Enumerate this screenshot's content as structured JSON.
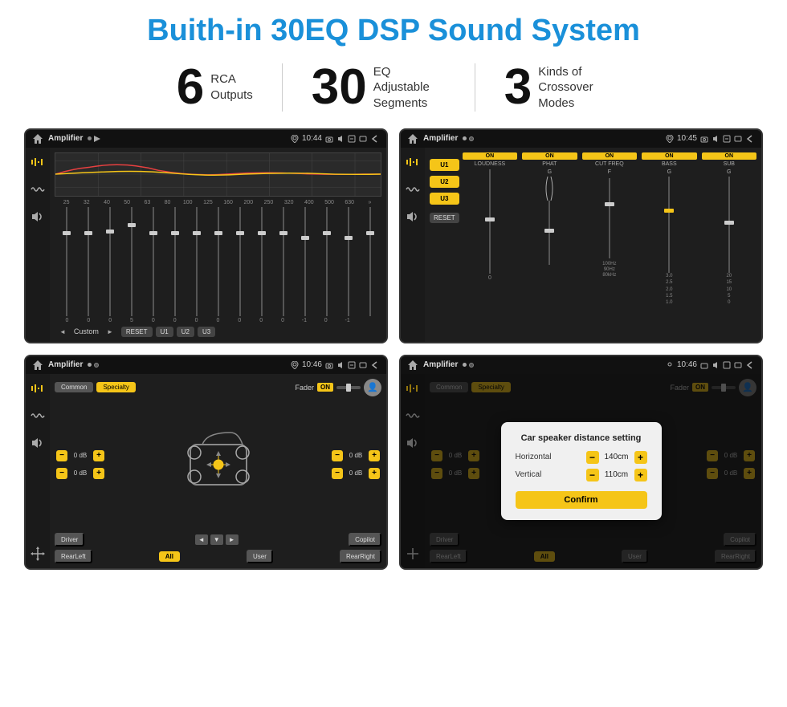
{
  "page": {
    "title": "Buith-in 30EQ DSP Sound System",
    "stats": [
      {
        "number": "6",
        "label": "RCA\nOutputs"
      },
      {
        "number": "30",
        "label": "EQ Adjustable\nSegments"
      },
      {
        "number": "3",
        "label": "Kinds of\nCrossover Modes"
      }
    ],
    "screens": [
      {
        "id": "eq-screen",
        "status_title": "Amplifier",
        "status_time": "10:44",
        "eq_freqs": [
          "25",
          "32",
          "40",
          "50",
          "63",
          "80",
          "100",
          "125",
          "160",
          "200",
          "250",
          "320",
          "400",
          "500",
          "630"
        ],
        "eq_values": [
          "0",
          "0",
          "0",
          "5",
          "0",
          "0",
          "0",
          "0",
          "0",
          "0",
          "0",
          "-1",
          "0",
          "-1"
        ],
        "eq_preset": "Custom",
        "eq_buttons": [
          "RESET",
          "U1",
          "U2",
          "U3"
        ]
      },
      {
        "id": "mixer-screen",
        "status_title": "Amplifier",
        "status_time": "10:45",
        "presets": [
          "U1",
          "U2",
          "U3"
        ],
        "channels": [
          {
            "on_label": "ON",
            "name": "LOUDNESS"
          },
          {
            "on_label": "ON",
            "name": "PHAT"
          },
          {
            "on_label": "ON",
            "name": "CUT FREQ"
          },
          {
            "on_label": "ON",
            "name": "BASS"
          },
          {
            "on_label": "ON",
            "name": "SUB"
          }
        ],
        "reset_label": "RESET"
      },
      {
        "id": "fader-screen",
        "status_title": "Amplifier",
        "status_time": "10:46",
        "tab_common": "Common",
        "tab_specialty": "Specialty",
        "fader_label": "Fader",
        "fader_on": "ON",
        "db_values": [
          "0 dB",
          "0 dB",
          "0 dB",
          "0 dB"
        ],
        "buttons": [
          "Driver",
          "Copilot",
          "RearLeft",
          "All",
          "User",
          "RearRight"
        ]
      },
      {
        "id": "dialog-screen",
        "status_title": "Amplifier",
        "status_time": "10:46",
        "tab_common": "Common",
        "tab_specialty": "Specialty",
        "fader_on": "ON",
        "dialog": {
          "title": "Car speaker distance setting",
          "fields": [
            {
              "label": "Horizontal",
              "value": "140cm"
            },
            {
              "label": "Vertical",
              "value": "110cm"
            }
          ],
          "confirm_label": "Confirm"
        },
        "db_values": [
          "0 dB",
          "0 dB"
        ],
        "buttons": [
          "Driver",
          "Copilot",
          "RearLeft",
          "All",
          "User",
          "RearRight"
        ]
      }
    ]
  }
}
